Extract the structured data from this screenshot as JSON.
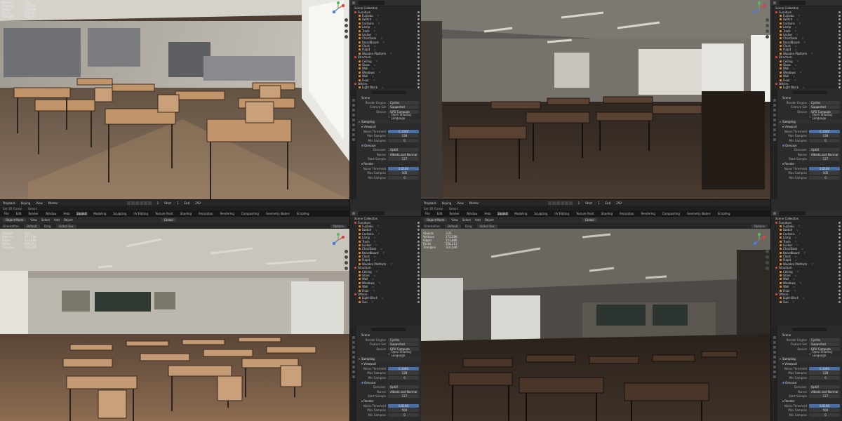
{
  "menu": {
    "items": [
      "File",
      "Edit",
      "Render",
      "Window",
      "Help"
    ],
    "workspaces": [
      "Layout",
      "Modeling",
      "Sculpting",
      "UV Editing",
      "Texture Paint",
      "Shading",
      "Animation",
      "Rendering",
      "Compositing",
      "Geometry Nodes",
      "Scripting"
    ],
    "scene_label": "Scene",
    "view_layer_label": "ViewLayer"
  },
  "header": {
    "mode": "Object Mode",
    "view": "View",
    "select": "Select",
    "add": "Add",
    "object": "Object",
    "orientation_label": "Orientation:",
    "orientation_value": "Default",
    "drag_label": "Drag:",
    "drag_value": "Select Box",
    "transform": "Global",
    "options": "Options"
  },
  "stats": {
    "labels": [
      "Objects",
      "Vertices",
      "Edges",
      "Faces",
      "Triangles"
    ],
    "values": [
      "1/21",
      "172,596",
      "153,880",
      "556,111",
      "316,540"
    ]
  },
  "timeline": {
    "playback": "Playback",
    "keying": "Keying",
    "view": "View",
    "marker": "Marker",
    "start_label": "Start",
    "start": "1",
    "end_label": "End",
    "end": "250",
    "frame": "1",
    "set_3d_cursor": "Set 3D Cursor",
    "select": "Select"
  },
  "outliner": {
    "root": "Scene Collection",
    "items": [
      {
        "label": "Furniture",
        "type": "coll",
        "sub": false
      },
      {
        "label": "Fujiraku",
        "type": "obj",
        "sub": true
      },
      {
        "label": "Switch",
        "type": "obj",
        "sub": true
      },
      {
        "label": "Curtains",
        "type": "obj",
        "sub": true
      },
      {
        "label": "Lamp",
        "type": "obj",
        "sub": true
      },
      {
        "label": "Trash",
        "type": "obj",
        "sub": true
      },
      {
        "label": "Locker",
        "type": "obj",
        "sub": true
      },
      {
        "label": "ChairDesk",
        "type": "obj",
        "sub": true
      },
      {
        "label": "BoardBoard",
        "type": "obj",
        "sub": true
      },
      {
        "label": "Clock",
        "type": "obj",
        "sub": true
      },
      {
        "label": "Pulpit",
        "type": "obj",
        "sub": true
      },
      {
        "label": "Wooden Platform",
        "type": "obj",
        "sub": true
      },
      {
        "label": "Structure",
        "type": "coll",
        "sub": false
      },
      {
        "label": "Ceiling",
        "type": "obj",
        "sub": true
      },
      {
        "label": "Glass",
        "type": "obj",
        "sub": true
      },
      {
        "label": "Wall",
        "type": "obj",
        "sub": true
      },
      {
        "label": "Windows",
        "type": "obj",
        "sub": true
      },
      {
        "label": "Wall",
        "type": "obj",
        "sub": true
      },
      {
        "label": "Floor",
        "type": "obj",
        "sub": true
      },
      {
        "label": "Others",
        "type": "coll",
        "sub": false
      },
      {
        "label": "Light Block",
        "type": "obj",
        "sub": true
      },
      {
        "label": "Sun",
        "type": "obj",
        "sub": true
      }
    ]
  },
  "properties": {
    "scene": "Scene",
    "render_engine_label": "Render Engine",
    "render_engine": "Cycles",
    "feature_set_label": "Feature Set",
    "feature_set": "Supported",
    "device_label": "Device",
    "device": "GPU Compute",
    "osl_label": "Open Shading Language",
    "sampling": "Sampling",
    "viewport": "Viewport",
    "noise_threshold_label": "Noise Threshold",
    "viewport_noise_threshold": "0.1000",
    "max_samples_label": "Max Samples",
    "viewport_max_samples": "128",
    "min_samples_label": "Min Samples",
    "viewport_min_samples": "0",
    "denoise": "Denoise",
    "denoiser_label": "Denoiser",
    "denoiser": "OptiX",
    "passes_label": "Passes",
    "passes": "Albedo and Normal",
    "start_sample_label": "Start Sample",
    "start_sample": "127",
    "render": "Render",
    "render_noise_threshold": "0.0100",
    "render_max_samples": "500",
    "render_min_samples": "0"
  }
}
